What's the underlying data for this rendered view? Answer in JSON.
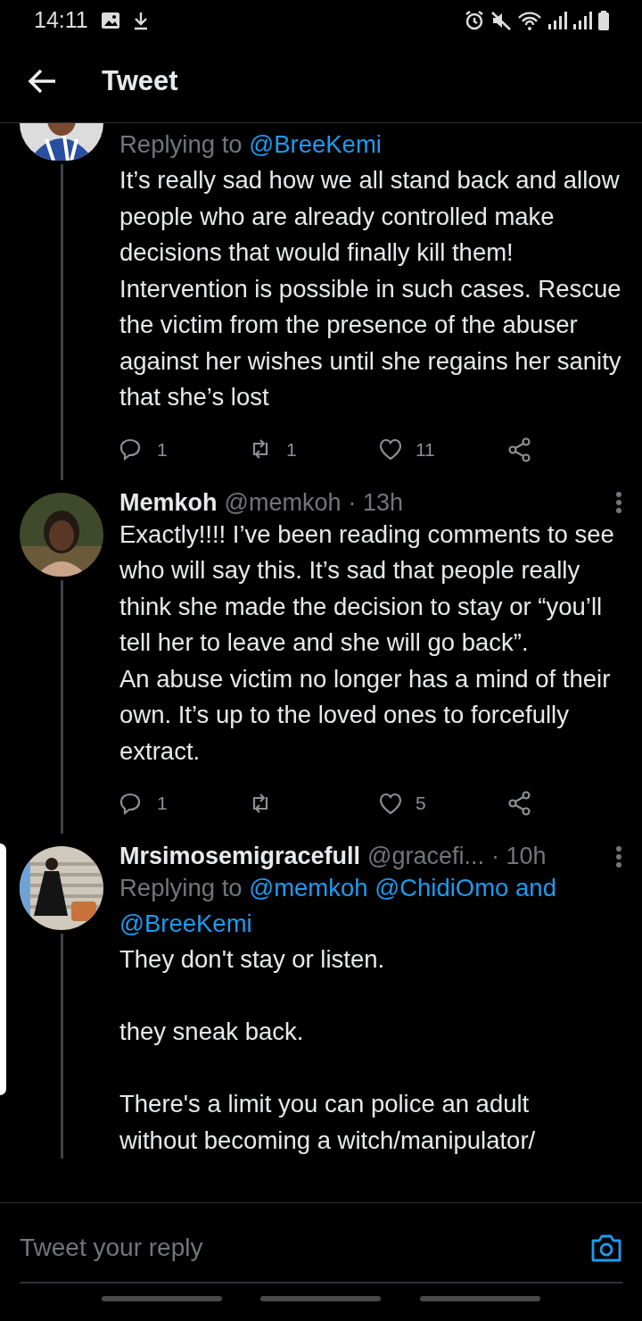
{
  "status_bar": {
    "time": "14:11"
  },
  "header": {
    "title": "Tweet"
  },
  "tweets": [
    {
      "replying_to": {
        "prefix": "Replying to",
        "mentions": "@BreeKemi"
      },
      "text": "It’s really sad how we all stand back and allow people who are already controlled make decisions that would finally kill them! Intervention is possible in such cases. Rescue the victim from the presence of the abuser against her wishes until she regains her sanity that she’s lost",
      "actions": {
        "replies": "1",
        "retweets": "1",
        "likes": "11"
      }
    },
    {
      "name": "Memkoh",
      "handle": "@memkoh",
      "time": "· 13h",
      "text": "Exactly!!!! I’ve been reading comments to see who will say this. It’s sad that people really think she made the decision to stay or “you’ll tell her to leave and she will go back”.\nAn abuse victim no longer has a mind of their own. It’s up to the loved ones to forcefully extract.",
      "actions": {
        "replies": "1",
        "likes": "5"
      }
    },
    {
      "name": "Mrsimosemigracefull",
      "handle": "@gracefi...",
      "time": "· 10h",
      "replying_to": {
        "prefix": "Replying to",
        "mentions": "@memkoh @ChidiOmo and @BreeKemi"
      },
      "text": "They don't stay or listen.\n\nthey sneak back.\n\nThere's a limit you can police an adult\nwithout becoming a witch/manipulator/"
    }
  ],
  "reply_bar": {
    "placeholder": "Tweet your reply"
  }
}
